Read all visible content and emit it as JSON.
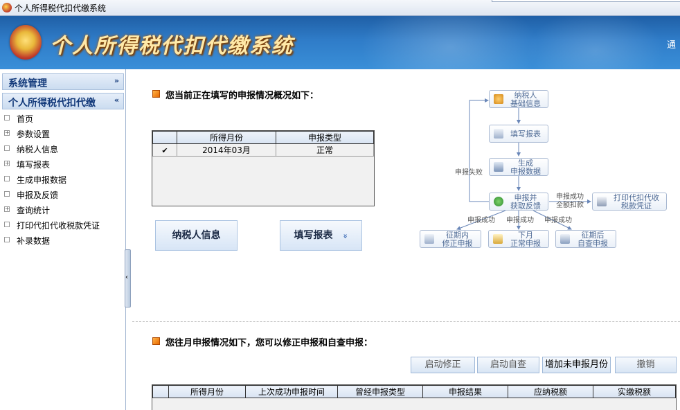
{
  "window": {
    "title": "个人所得税代扣代缴系统"
  },
  "banner": {
    "title": "个人所得税代扣代缴系统",
    "right_text": "通"
  },
  "sidebar": {
    "sections": [
      {
        "label": "系统管理",
        "chevron": "»"
      },
      {
        "label": "个人所得税代扣代缴",
        "chevron": "«"
      }
    ],
    "items": [
      {
        "label": "首页",
        "expander": ""
      },
      {
        "label": "参数设置",
        "expander": "+"
      },
      {
        "label": "纳税人信息",
        "expander": ""
      },
      {
        "label": "填写报表",
        "expander": "+"
      },
      {
        "label": "生成申报数据",
        "expander": ""
      },
      {
        "label": "申报及反馈",
        "expander": ""
      },
      {
        "label": "查询统计",
        "expander": "+"
      },
      {
        "label": "打印代扣代收税款凭证",
        "expander": ""
      },
      {
        "label": "补录数据",
        "expander": ""
      }
    ],
    "collapse_glyph": "‹"
  },
  "current": {
    "title": "您当前正在填写的申报情况概况如下：",
    "table": {
      "headers": [
        "",
        "所得月份",
        "申报类型"
      ],
      "rows": [
        {
          "checked": true,
          "check_glyph": "✔",
          "month": "2014年03月",
          "type": "正常"
        }
      ]
    },
    "buttons": {
      "taxpayer_info": "纳税人信息",
      "fill_report": "填写报表",
      "fill_report_glyph": "»"
    }
  },
  "flow": {
    "nodes": {
      "taxpayer": "纳税人\n基础信息",
      "fill": "填写报表",
      "generate": "生成\n申报数据",
      "declare": "申报并\n获取反馈",
      "print": "打印代扣代收\n税款凭证",
      "within": "征期内\n修正申报",
      "nextmonth": "下月\n正常申报",
      "after": "征期后\n自查申报"
    },
    "labels": {
      "fail": "申报失败",
      "success_full": "申报成功\n全额扣款",
      "success1": "申报成功",
      "success2": "申报成功",
      "success3": "申报成功"
    },
    "colors": {
      "line": "#6a87b8",
      "box_border": "#a9b9d2",
      "text": "#4e6a95"
    }
  },
  "history": {
    "title": "您往月申报情况如下，您可以修正申报和自查申报：",
    "buttons": {
      "start_correct": "启动修正",
      "start_self": "启动自查",
      "add_month": "增加未申报月份",
      "cancel": "撤销"
    },
    "table": {
      "headers": [
        "",
        "所得月份",
        "上次成功申报时间",
        "曾经申报类型",
        "申报结果",
        "应纳税额",
        "实缴税额"
      ]
    }
  }
}
